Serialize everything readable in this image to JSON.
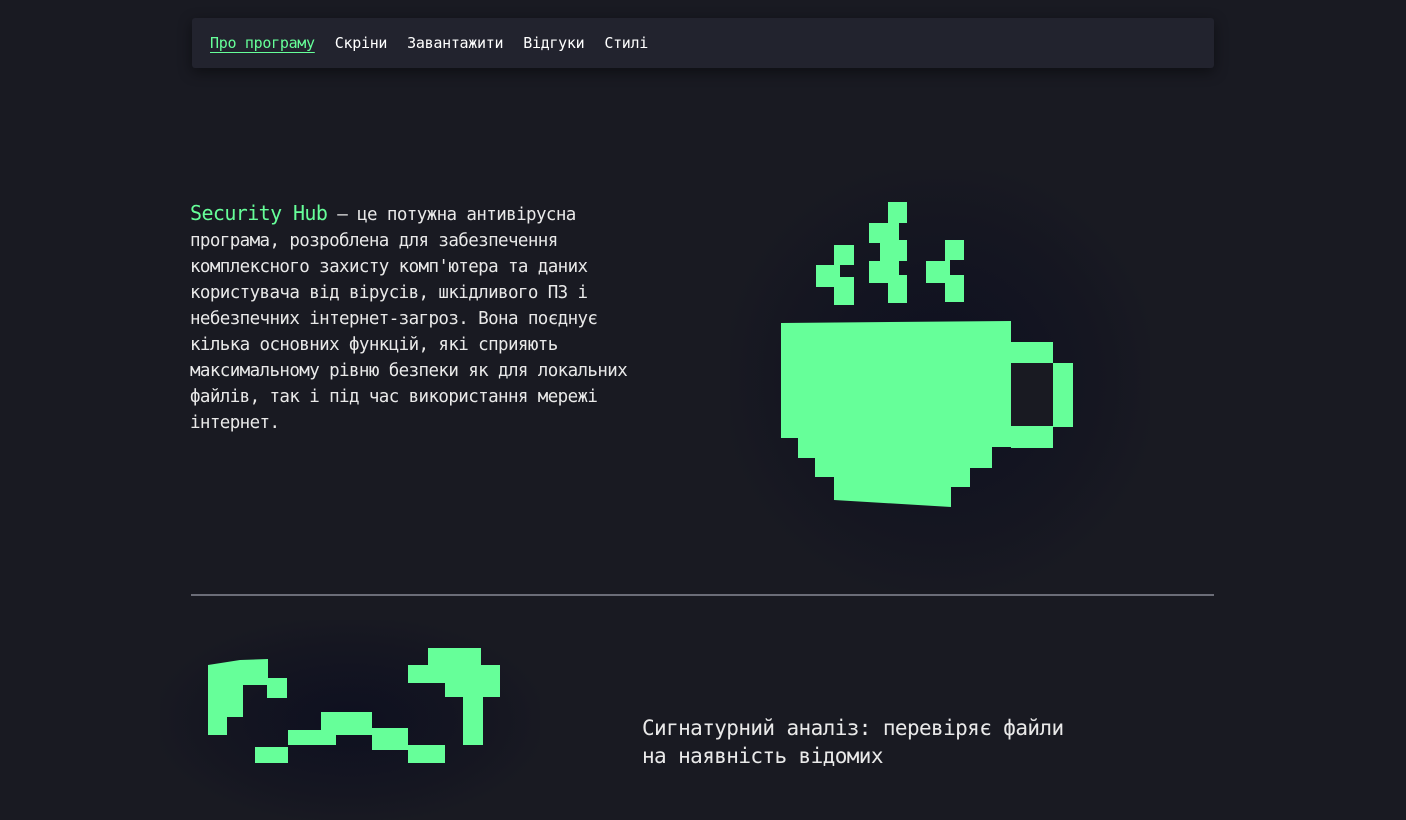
{
  "nav": {
    "items": [
      {
        "label": "Про програму",
        "active": true
      },
      {
        "label": "Скріни",
        "active": false
      },
      {
        "label": "Завантажити",
        "active": false
      },
      {
        "label": "Відгуки",
        "active": false
      },
      {
        "label": "Стилі",
        "active": false
      }
    ]
  },
  "intro": {
    "brand": "Security Hub",
    "text": " — це потужна антивірусна програма, розроблена для забезпечення комплексного захисту комп'ютера та даних користувача від вірусів, шкідливого ПЗ і небезпечних інтернет-загроз. Вона поєднує кілька основних функцій, які сприяють максимальному рівню безпеки як для локальних файлів, так і під час використання мережі інтернет."
  },
  "feature": {
    "text": "Сигнатурний аналіз: перевіряє файли на наявність відомих"
  },
  "icons": {
    "hero": "coffee-cup-icon",
    "feature": "shield-mask-icon"
  },
  "colors": {
    "accent": "#66ff99",
    "background": "#191a22",
    "nav_background": "#22232e",
    "text": "#e9e9e9"
  }
}
